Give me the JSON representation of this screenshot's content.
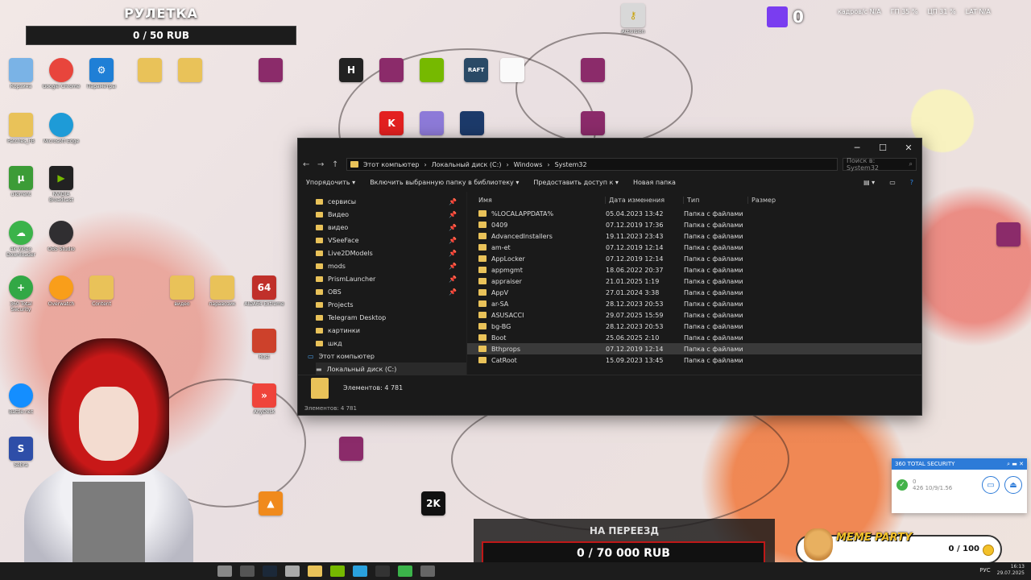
{
  "overlay": {
    "roulette_title": "РУЛЕТКА",
    "roulette_progress": "0 / 50 RUB",
    "twitch_count": "0",
    "stats": [
      "кадров/с N/A",
      "ГП 35 %",
      "ЦП 31 %",
      "LAT N/A"
    ],
    "goal_title": "НА ПЕРЕЕЗД",
    "goal_progress": "0 / 70 000 RUB",
    "meme_title": "MEME PARTY",
    "meme_progress": "0 / 100"
  },
  "explorer": {
    "breadcrumb": [
      "Этот компьютер",
      "Локальный диск (C:)",
      "Windows",
      "System32"
    ],
    "search_placeholder": "Поиск в: System32",
    "toolbar": [
      "Упорядочить ▾",
      "Включить выбранную папку в библиотеку ▾",
      "Предоставить доступ к ▾",
      "Новая папка"
    ],
    "nav": [
      {
        "label": "сервисы",
        "pinned": true
      },
      {
        "label": "Видео",
        "pinned": true
      },
      {
        "label": "видео",
        "pinned": true
      },
      {
        "label": "VSeeFace",
        "pinned": true
      },
      {
        "label": "Live2DModels",
        "pinned": true
      },
      {
        "label": "mods",
        "pinned": true
      },
      {
        "label": "PrismLauncher",
        "pinned": true
      },
      {
        "label": "OBS",
        "pinned": true
      },
      {
        "label": "Projects",
        "pinned": false
      },
      {
        "label": "Telegram Desktop",
        "pinned": false
      },
      {
        "label": "картинки",
        "pinned": false
      },
      {
        "label": "шкд",
        "pinned": false
      }
    ],
    "nav_pc": "Этот компьютер",
    "nav_disk": "Локальный диск (C:)",
    "columns": [
      "Имя",
      "Дата изменения",
      "Тип",
      "Размер"
    ],
    "rows": [
      {
        "name": "%LOCALAPPDATA%",
        "date": "05.04.2023 13:42",
        "type": "Папка с файлами"
      },
      {
        "name": "0409",
        "date": "07.12.2019 17:36",
        "type": "Папка с файлами"
      },
      {
        "name": "AdvancedInstallers",
        "date": "19.11.2023 23:43",
        "type": "Папка с файлами"
      },
      {
        "name": "am-et",
        "date": "07.12.2019 12:14",
        "type": "Папка с файлами"
      },
      {
        "name": "AppLocker",
        "date": "07.12.2019 12:14",
        "type": "Папка с файлами"
      },
      {
        "name": "appmgmt",
        "date": "18.06.2022 20:37",
        "type": "Папка с файлами"
      },
      {
        "name": "appraiser",
        "date": "21.01.2025 1:19",
        "type": "Папка с файлами"
      },
      {
        "name": "AppV",
        "date": "27.01.2024 3:38",
        "type": "Папка с файлами"
      },
      {
        "name": "ar-SA",
        "date": "28.12.2023 20:53",
        "type": "Папка с файлами"
      },
      {
        "name": "ASUSACCI",
        "date": "29.07.2025 15:59",
        "type": "Папка с файлами"
      },
      {
        "name": "bg-BG",
        "date": "28.12.2023 20:53",
        "type": "Папка с файлами"
      },
      {
        "name": "Boot",
        "date": "25.06.2025 2:10",
        "type": "Папка с файлами"
      },
      {
        "name": "Bthprops",
        "date": "07.12.2019 12:14",
        "type": "Папка с файлами"
      },
      {
        "name": "CatRoot",
        "date": "15.09.2023 13:45",
        "type": "Папка с файлами"
      }
    ],
    "selected_index": 12,
    "preview_count": "Элементов: 4 781",
    "status_count": "Элементов: 4 781"
  },
  "sec360": {
    "title": "360 TOTAL SECURITY",
    "line1": "0",
    "line2": "426 10/9/1.56"
  },
  "taskbar": {
    "lang": "РУС",
    "time": "16:13",
    "date": "29.07.2025"
  },
  "desktop_icons": [
    {
      "label": "Корзина",
      "color": "#7ab3e6"
    },
    {
      "label": "Google Chrome",
      "color": "#e8453c"
    },
    {
      "label": "Параметры",
      "color": "#1f7fd6"
    },
    {
      "label": "Patches_FB",
      "color": "#e9c259"
    },
    {
      "label": "Microsoft Edge",
      "color": "#1e9bd7"
    },
    {
      "label": "uTorrent",
      "color": "#3c9c37"
    },
    {
      "label": "NVIDIA Broadcast",
      "color": "#76b900"
    },
    {
      "label": "4K Video Downloader",
      "color": "#3bb34a"
    },
    {
      "label": "OBS Studio",
      "color": "#302e31"
    },
    {
      "label": "360 Total Security",
      "color": "#32a845"
    },
    {
      "label": "Overwatch",
      "color": "#f99e1a"
    },
    {
      "label": "Battle.net",
      "color": "#148eff"
    },
    {
      "label": "Sebra",
      "color": "#2e4ea8"
    },
    {
      "label": "AnyDesk",
      "color": "#ef443b"
    },
    {
      "label": "Content",
      "color": "#e9c259"
    },
    {
      "label": "видео",
      "color": "#e9c259"
    },
    {
      "label": "AIDA64 Extreme",
      "color": "#c0302a"
    },
    {
      "label": "Rust",
      "color": "#cd412b"
    },
    {
      "label": "паравозик",
      "color": "#e9c259"
    },
    {
      "label": "Activision",
      "color": "#d8d8d8"
    }
  ]
}
